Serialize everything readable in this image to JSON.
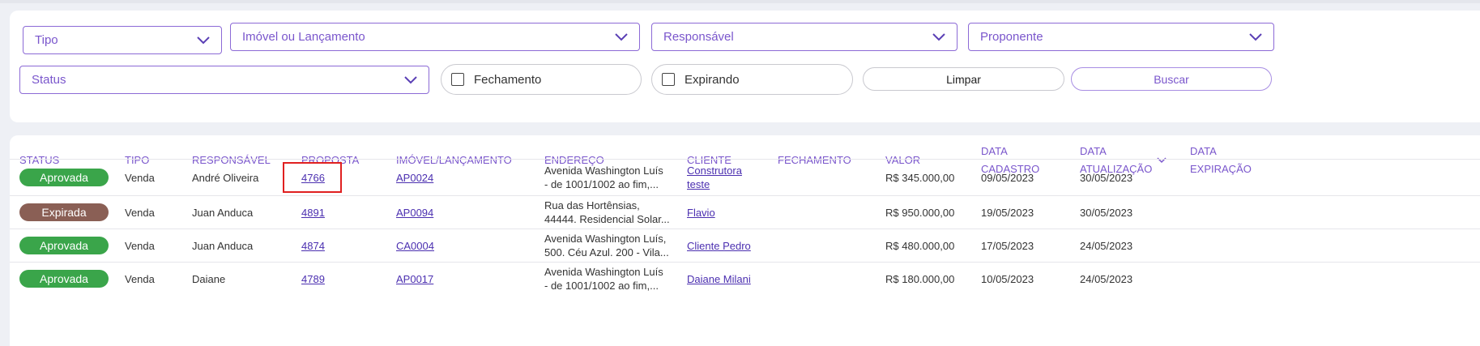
{
  "colors": {
    "accent": "#7a56cc",
    "approved": "#3aa54a",
    "expired": "#8a5f55",
    "highlight": "#e02020"
  },
  "filters": {
    "tipo": "Tipo",
    "imovel": "Imóvel ou Lançamento",
    "responsavel": "Responsável",
    "proponente": "Proponente",
    "status": "Status",
    "fechamento": "Fechamento",
    "expirando": "Expirando",
    "limpar": "Limpar",
    "buscar": "Buscar"
  },
  "table": {
    "headers": {
      "status": "STATUS",
      "tipo": "TIPO",
      "responsavel": "RESPONSÁVEL",
      "proposta": "PROPOSTA",
      "imovel": "IMÓVEL/LANÇAMENTO",
      "endereco": "ENDEREÇO",
      "cliente": "CLIENTE",
      "fechamento": "FECHAMENTO",
      "valor": "VALOR",
      "data_cadastro_1": "DATA",
      "data_cadastro_2": "CADASTRO",
      "data_atualizacao_1": "DATA",
      "data_atualizacao_2": "ATUALIZAÇÃO",
      "data_expiracao_1": "DATA",
      "data_expiracao_2": "EXPIRAÇÃO"
    },
    "rows": [
      {
        "status": "Aprovada",
        "tipo": "Venda",
        "responsavel": "André Oliveira",
        "proposta": "4766",
        "imovel": "AP0024",
        "endereco_1": "Avenida Washington Luís",
        "endereco_2": "- de 1001/1002 ao fim,...",
        "cliente_1": "Construtora",
        "cliente_2": "teste",
        "fechamento": "",
        "valor": "R$ 345.000,00",
        "data_cadastro": "09/05/2023",
        "data_atualizacao": "30/05/2023",
        "data_expiracao": ""
      },
      {
        "status": "Expirada",
        "tipo": "Venda",
        "responsavel": "Juan Anduca",
        "proposta": "4891",
        "imovel": "AP0094",
        "endereco_1": "Rua das Hortênsias,",
        "endereco_2": "44444. Residencial Solar...",
        "cliente_1": "Flavio",
        "cliente_2": "",
        "fechamento": "",
        "valor": "R$ 950.000,00",
        "data_cadastro": "19/05/2023",
        "data_atualizacao": "30/05/2023",
        "data_expiracao": ""
      },
      {
        "status": "Aprovada",
        "tipo": "Venda",
        "responsavel": "Juan Anduca",
        "proposta": "4874",
        "imovel": "CA0004",
        "endereco_1": "Avenida Washington Luís,",
        "endereco_2": "500. Céu Azul. 200 - Vila...",
        "cliente_1": "Cliente Pedro",
        "cliente_2": "",
        "fechamento": "",
        "valor": "R$ 480.000,00",
        "data_cadastro": "17/05/2023",
        "data_atualizacao": "24/05/2023",
        "data_expiracao": ""
      },
      {
        "status": "Aprovada",
        "tipo": "Venda",
        "responsavel": "Daiane",
        "proposta": "4789",
        "imovel": "AP0017",
        "endereco_1": "Avenida Washington Luís",
        "endereco_2": "- de 1001/1002 ao fim,...",
        "cliente_1": "Daiane Milani",
        "cliente_2": "",
        "fechamento": "",
        "valor": "R$ 180.000,00",
        "data_cadastro": "10/05/2023",
        "data_atualizacao": "24/05/2023",
        "data_expiracao": ""
      }
    ]
  }
}
